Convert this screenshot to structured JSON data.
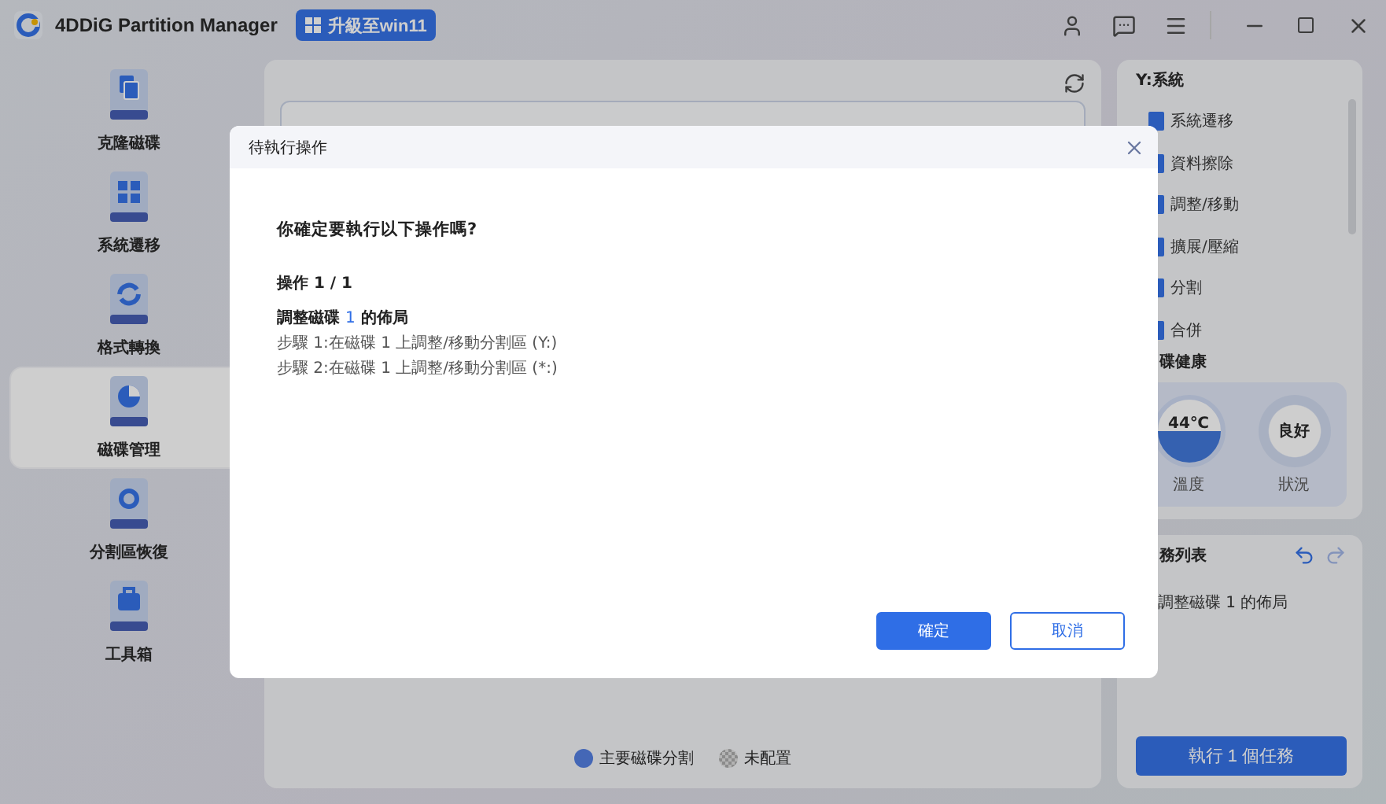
{
  "window": {
    "title": "4DDiG Partition Manager",
    "upgrade_button": "升級至win11"
  },
  "sidebar": {
    "items": [
      {
        "label": "克隆磁碟",
        "selected": false
      },
      {
        "label": "系統遷移",
        "selected": false
      },
      {
        "label": "格式轉換",
        "selected": false
      },
      {
        "label": "磁碟管理",
        "selected": true
      },
      {
        "label": "分割區恢復",
        "selected": false
      },
      {
        "label": "工具箱",
        "selected": false
      }
    ]
  },
  "legend": [
    {
      "label": "主要磁碟分割",
      "kind": "primary"
    },
    {
      "label": "未配置",
      "kind": "unallocated"
    }
  ],
  "partition_panel": {
    "title": "Y:系統",
    "actions": [
      "系統遷移",
      "資料擦除",
      "調整/移動",
      "擴展/壓縮",
      "分割",
      "合併"
    ],
    "health_title": "碟健康",
    "temperature": "44℃",
    "temperature_label": "溫度",
    "status": "良好",
    "status_label": "狀況"
  },
  "task_panel": {
    "title": "務列表",
    "tasks": [
      "調整磁碟 1 的佈局"
    ],
    "run_button": "執行 1 個任務"
  },
  "dialog": {
    "title": "待執行操作",
    "question": "你確定要執行以下操作嗎?",
    "operation": "操作 1 / 1",
    "layout": {
      "prefix": "調整磁碟",
      "disk": "1",
      "suffix": "的佈局"
    },
    "steps": [
      "步驟 1:在磁碟 1 上調整/移動分割區 (Y:)",
      "步驟 2:在磁碟 1 上調整/移動分割區 (*:)"
    ],
    "buttons": [
      {
        "label": "確定",
        "kind": "primary"
      },
      {
        "label": "取消",
        "kind": "secondary"
      }
    ]
  }
}
